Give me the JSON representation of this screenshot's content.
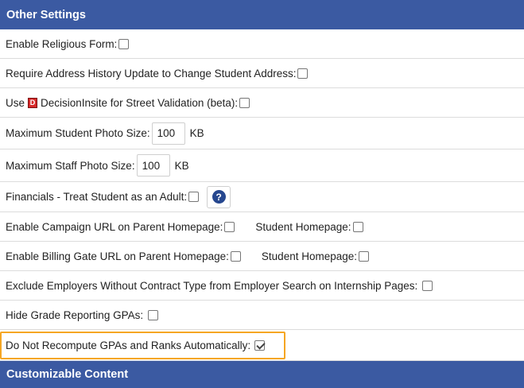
{
  "header": {
    "title": "Other Settings"
  },
  "rows": {
    "religious": {
      "label": "Enable Religious Form:"
    },
    "address_history": {
      "label": "Require Address History Update to Change Student Address:"
    },
    "decision": {
      "prefix": "Use",
      "icon": "D",
      "label": "DecisionInsite for Street Validation (beta):"
    },
    "student_photo": {
      "label": "Maximum Student Photo Size:",
      "value": "100",
      "unit": "KB"
    },
    "staff_photo": {
      "label": "Maximum Staff Photo Size:",
      "value": "100",
      "unit": "KB"
    },
    "financials": {
      "label": "Financials - Treat Student as an Adult:",
      "help": "?"
    },
    "campaign": {
      "label": "Enable Campaign URL on Parent Homepage:",
      "label2": "Student Homepage:"
    },
    "billing": {
      "label": "Enable Billing Gate URL on Parent Homepage:",
      "label2": "Student Homepage:"
    },
    "employers": {
      "label": "Exclude Employers Without Contract Type from Employer Search on Internship Pages:"
    },
    "hide_gpa": {
      "label": "Hide Grade Reporting GPAs:"
    },
    "recompute": {
      "label": "Do Not Recompute GPAs and Ranks Automatically:",
      "checked": true
    }
  },
  "footer": {
    "title": "Customizable Content"
  },
  "colors": {
    "header_bg": "#3b5aa2",
    "highlight": "#f5a623"
  }
}
